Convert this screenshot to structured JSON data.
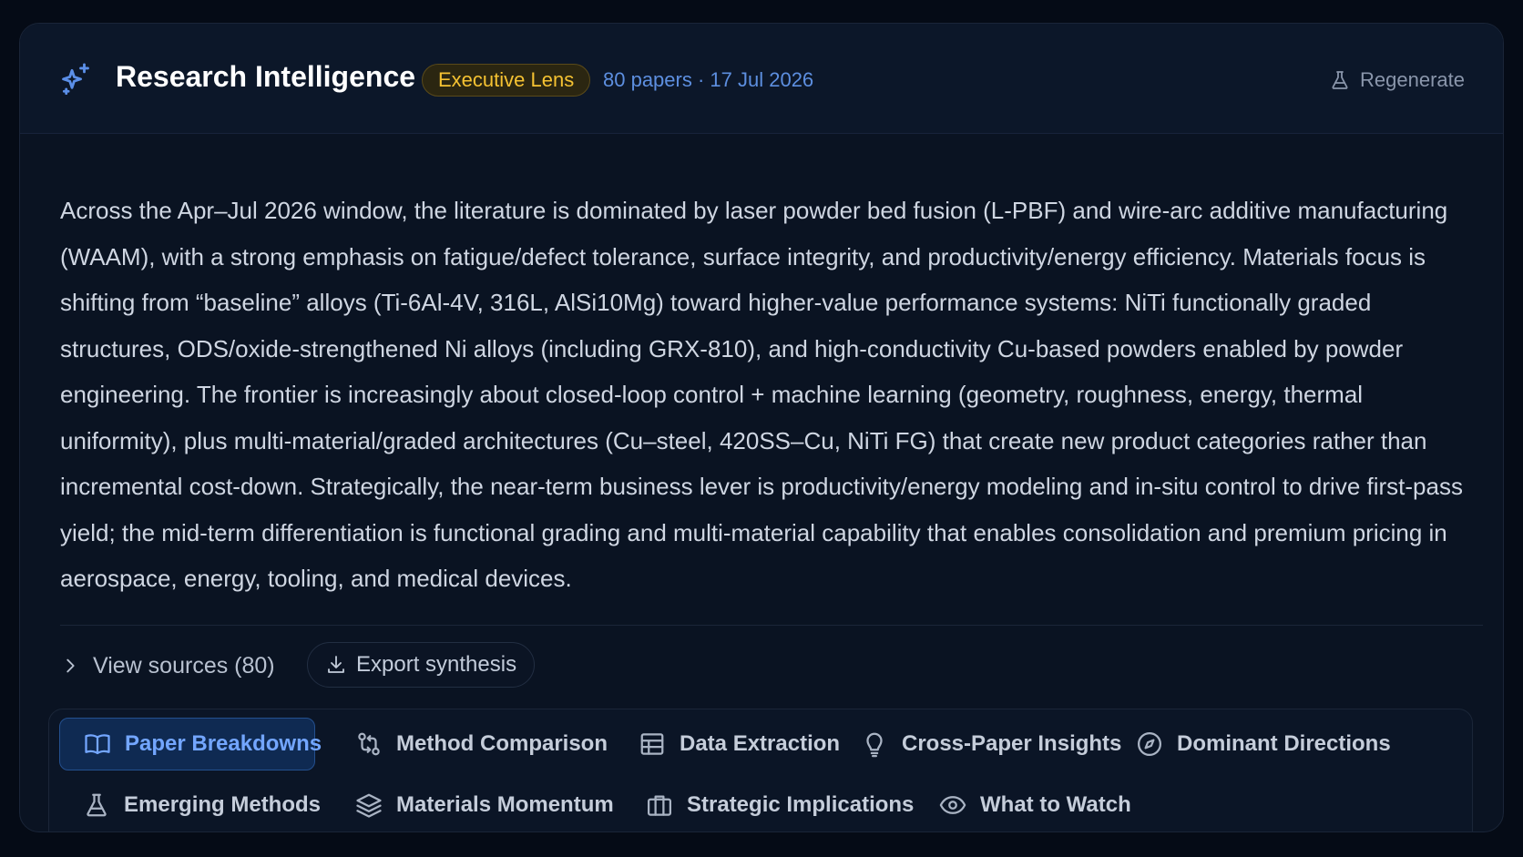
{
  "header": {
    "title": "Research Intelligence",
    "lens_badge": "Executive Lens",
    "meta": "80 papers · 17 Jul 2026",
    "regenerate_label": "Regenerate"
  },
  "summary": "Across the Apr–Jul 2026 window, the literature is dominated by laser powder bed fusion (L-PBF) and wire-arc additive manufacturing (WAAM), with a strong emphasis on fatigue/defect tolerance, surface integrity, and productivity/energy efficiency. Materials focus is shifting from “baseline” alloys (Ti-6Al-4V, 316L, AlSi10Mg) toward higher-value performance systems: NiTi functionally graded structures, ODS/oxide-strengthened Ni alloys (including GRX-810), and high-conductivity Cu-based powders enabled by powder engineering. The frontier is increasingly about closed-loop control + machine learning (geometry, roughness, energy, thermal uniformity), plus multi-material/graded architectures (Cu–steel, 420SS–Cu, NiTi FG) that create new product categories rather than incremental cost-down. Strategically, the near-term business lever is productivity/energy modeling and in-situ control to drive first-pass yield; the mid-term differentiation is functional grading and multi-material capability that enables consolidation and premium pricing in aerospace, energy, tooling, and medical devices.",
  "actions": {
    "view_sources_label": "View sources (80)",
    "export_label": "Export synthesis"
  },
  "tabs": [
    {
      "label": "Paper Breakdowns",
      "icon": "book-open-icon",
      "active": true
    },
    {
      "label": "Method Comparison",
      "icon": "git-compare-icon",
      "active": false
    },
    {
      "label": "Data Extraction",
      "icon": "table-icon",
      "active": false
    },
    {
      "label": "Cross-Paper Insights",
      "icon": "lightbulb-icon",
      "active": false
    },
    {
      "label": "Dominant Directions",
      "icon": "compass-icon",
      "active": false
    },
    {
      "label": "Emerging Methods",
      "icon": "flask-icon",
      "active": false
    },
    {
      "label": "Materials Momentum",
      "icon": "layers-icon",
      "active": false
    },
    {
      "label": "Strategic Implications",
      "icon": "briefcase-icon",
      "active": false
    },
    {
      "label": "What to Watch",
      "icon": "eye-icon",
      "active": false
    }
  ],
  "colors": {
    "accent": "#73a6ff",
    "badge_text": "#f5c232",
    "meta_text": "#5d8fe0",
    "background": "#0a1322"
  }
}
